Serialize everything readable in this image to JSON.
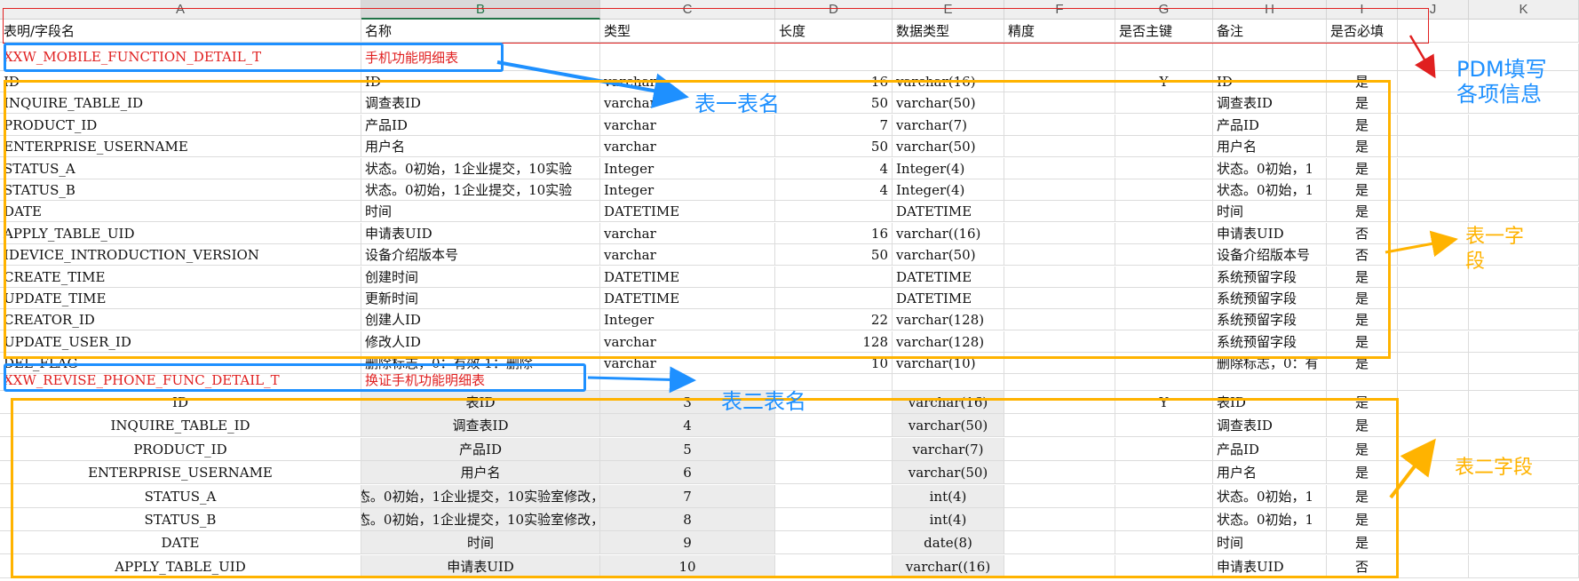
{
  "columns": [
    "A",
    "B",
    "C",
    "D",
    "E",
    "F",
    "G",
    "H",
    "I",
    "J",
    "K"
  ],
  "header_row": [
    "表明/字段名",
    "名称",
    "类型",
    "长度",
    "数据类型",
    "精度",
    "是否主键",
    "备注",
    "是否必填"
  ],
  "table1": {
    "name": "XXW_MOBILE_FUNCTION_DETAIL_T",
    "title": "手机功能明细表",
    "rows": [
      [
        "ID",
        "ID",
        "varchar",
        "16",
        "varchar(16)",
        "",
        "Y",
        "ID",
        "是"
      ],
      [
        "INQUIRE_TABLE_ID",
        "调查表ID",
        "varchar",
        "50",
        "varchar(50)",
        "",
        "",
        "调查表ID",
        "是"
      ],
      [
        "PRODUCT_ID",
        "产品ID",
        "varchar",
        "7",
        "varchar(7)",
        "",
        "",
        "产品ID",
        "是"
      ],
      [
        "ENTERPRISE_USERNAME",
        "用户名",
        "varchar",
        "50",
        "varchar(50)",
        "",
        "",
        "用户名",
        "是"
      ],
      [
        "STATUS_A",
        "状态。0初始，1企业提交，10实验",
        "Integer",
        "4",
        "Integer(4)",
        "",
        "",
        "状态。0初始，1",
        "是"
      ],
      [
        "STATUS_B",
        "状态。0初始，1企业提交，10实验",
        "Integer",
        "4",
        "Integer(4)",
        "",
        "",
        "状态。0初始，1",
        "是"
      ],
      [
        "DATE",
        "时间",
        "DATETIME",
        "",
        "DATETIME",
        "",
        "",
        "时间",
        "是"
      ],
      [
        "APPLY_TABLE_UID",
        "申请表UID",
        "varchar",
        "16",
        "varchar((16)",
        "",
        "",
        "申请表UID",
        "否"
      ],
      [
        "IDEVICE_INTRODUCTION_VERSION",
        "设备介绍版本号",
        "varchar",
        "50",
        "varchar(50)",
        "",
        "",
        "设备介绍版本号",
        "否"
      ],
      [
        "CREATE_TIME",
        "创建时间",
        "DATETIME",
        "",
        "DATETIME",
        "",
        "",
        "系统预留字段",
        "是"
      ],
      [
        "UPDATE_TIME",
        "更新时间",
        "DATETIME",
        "",
        "DATETIME",
        "",
        "",
        "系统预留字段",
        "是"
      ],
      [
        "CREATOR_ID",
        "创建人ID",
        "Integer",
        "22",
        "varchar(128)",
        "",
        "",
        "系统预留字段",
        "是"
      ],
      [
        "UPDATE_USER_ID",
        "修改人ID",
        "varchar",
        "128",
        "varchar(128)",
        "",
        "",
        "系统预留字段",
        "是"
      ],
      [
        "DEL_FLAG",
        "删除标志，0：有效 1：删除",
        "varchar",
        "10",
        "varchar(10)",
        "",
        "",
        "删除标志，0：有",
        "是"
      ]
    ]
  },
  "table2": {
    "name": "XXW_REVISE_PHONE_FUNC_DETAIL_T",
    "title": "换证手机功能明细表",
    "rows": [
      [
        "ID",
        "表ID",
        "3",
        "",
        "varchar(16)",
        "",
        "Y",
        "表ID",
        "是"
      ],
      [
        "INQUIRE_TABLE_ID",
        "调查表ID",
        "4",
        "",
        "varchar(50)",
        "",
        "",
        "调查表ID",
        "是"
      ],
      [
        "PRODUCT_ID",
        "产品ID",
        "5",
        "",
        "varchar(7)",
        "",
        "",
        "产品ID",
        "是"
      ],
      [
        "ENTERPRISE_USERNAME",
        "用户名",
        "6",
        "",
        "varchar(50)",
        "",
        "",
        "用户名",
        "是"
      ],
      [
        "STATUS_A",
        "态。0初始，1企业提交，10实验室修改，",
        "7",
        "",
        "int(4)",
        "",
        "",
        "状态。0初始，1",
        "是"
      ],
      [
        "STATUS_B",
        "态。0初始，1企业提交，10实验室修改，",
        "8",
        "",
        "int(4)",
        "",
        "",
        "状态。0初始，1",
        "是"
      ],
      [
        "DATE",
        "时间",
        "9",
        "",
        "date(8)",
        "",
        "",
        "时间",
        "是"
      ],
      [
        "APPLY_TABLE_UID",
        "申请表UID",
        "10",
        "",
        "varchar((16)",
        "",
        "",
        "申请表UID",
        "否"
      ]
    ]
  },
  "annotations": {
    "pdm": "PDM填写\n各项信息",
    "pdm_line1": "PDM填写",
    "pdm_line2": "各项信息",
    "t1name": "表一表名",
    "t1field_1": "表一字",
    "t1field_2": "段",
    "t2name": "表二表名",
    "t2field": "表二字段"
  },
  "colors": {
    "red": "#e02020",
    "blue": "#1e90ff",
    "orange": "#ffb300",
    "selected_header": "#217346"
  }
}
